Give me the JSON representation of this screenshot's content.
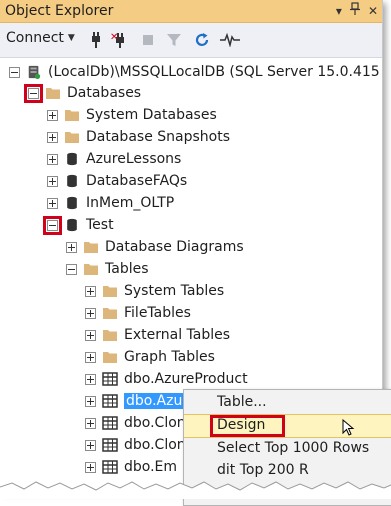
{
  "window": {
    "title": "Object Explorer",
    "pin_icon": "pin-icon",
    "close_icon": "close-icon"
  },
  "toolbar": {
    "connect_label": "Connect",
    "icons": [
      "connect-plug-icon",
      "disconnect-icon",
      "stop-icon",
      "filter-icon",
      "refresh-icon",
      "activity-monitor-icon"
    ]
  },
  "tree": {
    "server": "(LocalDb)\\MSSQLLocalDB (SQL Server 15.0.415",
    "databases": "Databases",
    "system_databases": "System Databases",
    "database_snapshots": "Database Snapshots",
    "db_azurelessons": "AzureLessons",
    "db_databasefaqs": "DatabaseFAQs",
    "db_inmem": "InMem_OLTP",
    "db_test": "Test",
    "database_diagrams": "Database Diagrams",
    "tables": "Tables",
    "system_tables": "System Tables",
    "file_tables": "FileTables",
    "external_tables": "External Tables",
    "graph_tables": "Graph Tables",
    "t_azureproduct": "dbo.AzureProduct",
    "t_azure_selected": "dbo.Azur",
    "t_clon1": "dbo.Clon",
    "t_clon2": "dbo.Clon",
    "t_emp": "dbo.Em"
  },
  "context_menu": {
    "items": [
      "Table...",
      "Design",
      "Select Top 1000 Rows",
      "dit Top 200 R"
    ],
    "highlighted": "Design"
  },
  "colors": {
    "highlight_box": "#d0021b",
    "selection": "#3399ff",
    "titlebar": "#f5cc84"
  }
}
